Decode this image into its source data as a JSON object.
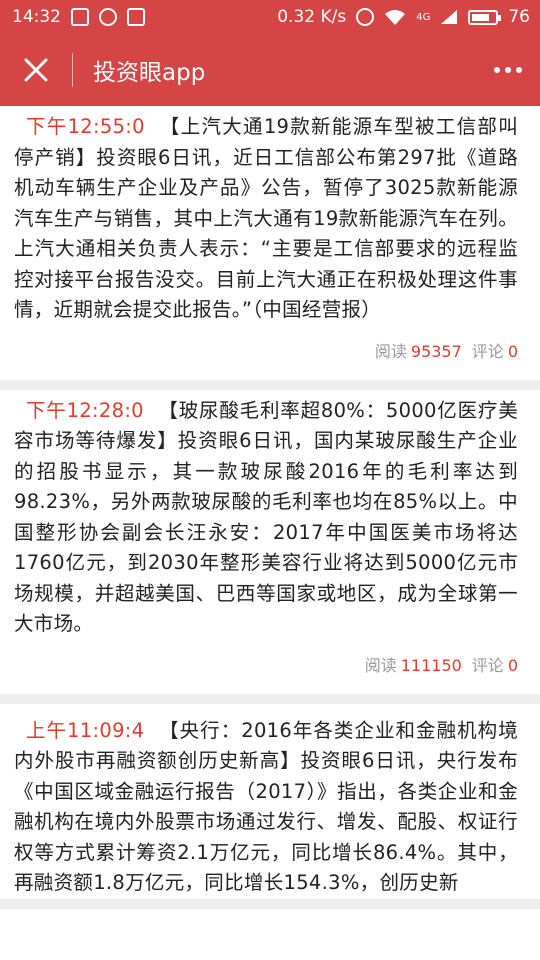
{
  "status_bar": {
    "time": "14:32",
    "speed": "0.32 K/s",
    "signal": "4G",
    "battery": "76",
    "battery_level": 0.76
  },
  "nav": {
    "title": "投资眼app",
    "close_icon": "close-icon",
    "more_icon": "more-dots-icon"
  },
  "colors": {
    "header": "#d64545",
    "accent": "#e23b2e"
  },
  "news": [
    {
      "time": "下午12:55:0",
      "body": "【上汽大通19款新能源车型被工信部叫停产销】投资眼6日讯，近日工信部公布第297批《道路机动车辆生产企业及产品》公告，暂停了3025款新能源汽车生产与销售，其中上汽大通有19款新能源汽车在列。上汽大通相关负责人表示：“主要是工信部要求的远程监控对接平台报告没交。目前上汽大通正在积极处理这件事情，近期就会提交此报告。”（中国经营报）",
      "read_label": "阅读",
      "reads": "95357",
      "comment_label": "评论",
      "comments": "0"
    },
    {
      "time": "下午12:28:0",
      "body": "【玻尿酸毛利率超80%：5000亿医疗美容市场等待爆发】投资眼6日讯，国内某玻尿酸生产企业的招股书显示，其一款玻尿酸2016年的毛利率达到98.23%，另外两款玻尿酸的毛利率也均在85%以上。中国整形协会副会长汪永安：2017年中国医美市场将达1760亿元，到2030年整形美容行业将达到5000亿元市场规模，并超越美国、巴西等国家或地区，成为全球第一大市场。",
      "read_label": "阅读",
      "reads": "111150",
      "comment_label": "评论",
      "comments": "0"
    },
    {
      "time": "上午11:09:4",
      "body": "【央行：2016年各类企业和金融机构境内外股市再融资额创历史新高】投资眼6日讯，央行发布《中国区域金融运行报告（2017）》指出，各类企业和金融机构在境内外股票市场通过发行、增发、配股、权证行权等方式累计筹资2.1万亿元，同比增长86.4%。其中，再融资额1.8万亿元，同比增长154.3%，创历史新",
      "read_label": "",
      "reads": "",
      "comment_label": "",
      "comments": ""
    }
  ]
}
